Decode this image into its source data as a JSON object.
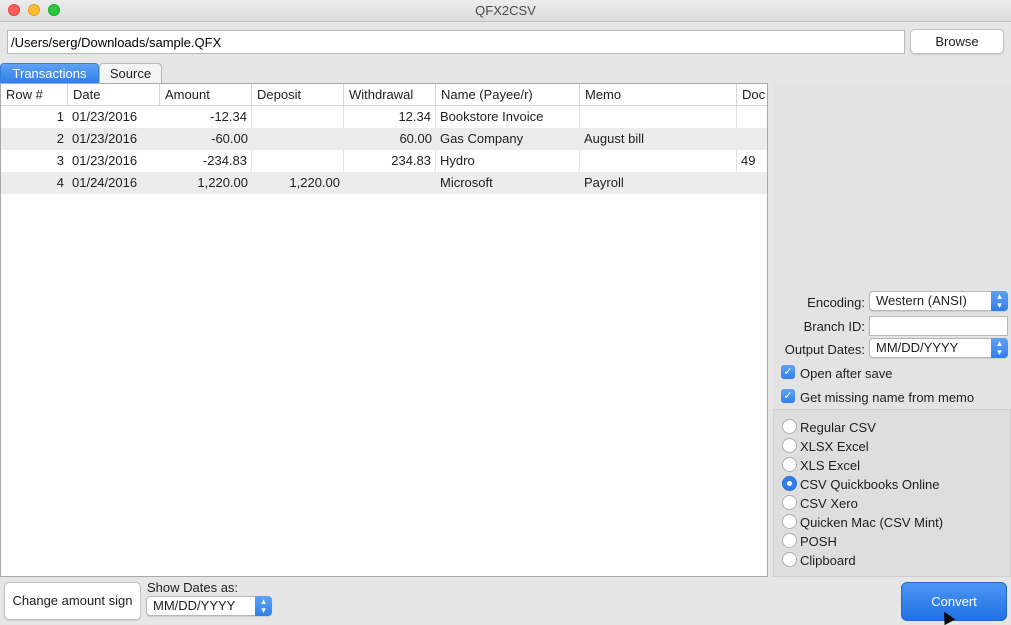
{
  "window": {
    "title": "QFX2CSV"
  },
  "file": {
    "path": "/Users/serg/Downloads/sample.QFX",
    "browse_label": "Browse"
  },
  "tabs": [
    {
      "label": "Transactions",
      "active": true
    },
    {
      "label": "Source",
      "active": false
    }
  ],
  "table": {
    "columns": [
      "Row #",
      "Date",
      "Amount",
      "Deposit",
      "Withdrawal",
      "Name (Payee/r)",
      "Memo",
      "Doc"
    ],
    "rows": [
      {
        "row": "1",
        "date": "01/23/2016",
        "amount": "-12.34",
        "deposit": "",
        "withdrawal": "12.34",
        "name": "Bookstore Invoice",
        "memo": "",
        "doc": ""
      },
      {
        "row": "2",
        "date": "01/23/2016",
        "amount": "-60.00",
        "deposit": "",
        "withdrawal": "60.00",
        "name": "Gas Company",
        "memo": "August bill",
        "doc": ""
      },
      {
        "row": "3",
        "date": "01/23/2016",
        "amount": "-234.83",
        "deposit": "",
        "withdrawal": "234.83",
        "name": "Hydro",
        "memo": "",
        "doc": "49"
      },
      {
        "row": "4",
        "date": "01/24/2016",
        "amount": "1,220.00",
        "deposit": "1,220.00",
        "withdrawal": "",
        "name": "Microsoft",
        "memo": "Payroll",
        "doc": ""
      }
    ]
  },
  "settings": {
    "encoding_label": "Encoding:",
    "encoding_value": "Western (ANSI)",
    "branch_label": "Branch ID:",
    "branch_value": "",
    "output_dates_label": "Output Dates:",
    "output_dates_value": "MM/DD/YYYY",
    "open_after_save_label": "Open after save",
    "open_after_save_checked": true,
    "missing_name_label": "Get missing name from memo",
    "missing_name_checked": true
  },
  "formats": {
    "options": [
      "Regular CSV",
      "XLSX Excel",
      "XLS Excel",
      "CSV Quickbooks Online",
      "CSV Xero",
      "Quicken Mac (CSV Mint)",
      "POSH",
      "Clipboard"
    ],
    "selected": "CSV Quickbooks Online"
  },
  "bottom": {
    "change_sign_label": "Change amount sign",
    "show_dates_label": "Show Dates as:",
    "show_dates_value": "MM/DD/YYYY",
    "convert_label": "Convert"
  },
  "colors": {
    "accent": "#2f7fe9",
    "row_alt": "#ececec"
  }
}
